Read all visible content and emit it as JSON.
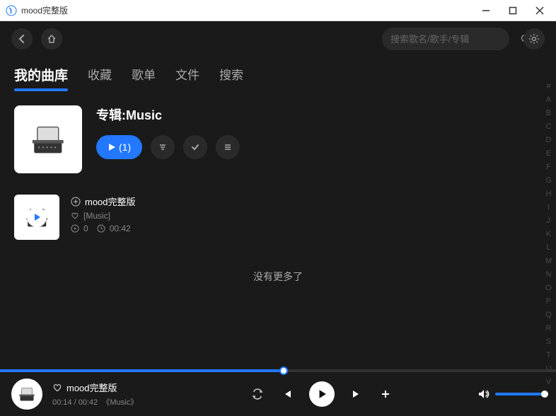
{
  "window": {
    "title": "mood完整版"
  },
  "search": {
    "placeholder": "搜索歌名/歌手/专辑"
  },
  "tabs": [
    {
      "label": "我的曲库",
      "active": true
    },
    {
      "label": "收藏",
      "active": false
    },
    {
      "label": "歌单",
      "active": false
    },
    {
      "label": "文件",
      "active": false
    },
    {
      "label": "搜索",
      "active": false
    }
  ],
  "album": {
    "title": "专辑:Music",
    "play_all_label": "(1)"
  },
  "tracks": [
    {
      "title": "mood完整版",
      "subtitle": "[Music]",
      "play_count": "0",
      "duration": "00:42"
    }
  ],
  "no_more": "没有更多了",
  "alpha_index": [
    "#",
    "A",
    "B",
    "C",
    "D",
    "E",
    "F",
    "G",
    "H",
    "I",
    "J",
    "K",
    "L",
    "M",
    "N",
    "O",
    "P",
    "Q",
    "R",
    "S",
    "T",
    "U",
    "V"
  ],
  "player": {
    "title": "mood完整版",
    "current_time": "00:14",
    "total_time": "00:42",
    "album_label": "《Music》"
  }
}
